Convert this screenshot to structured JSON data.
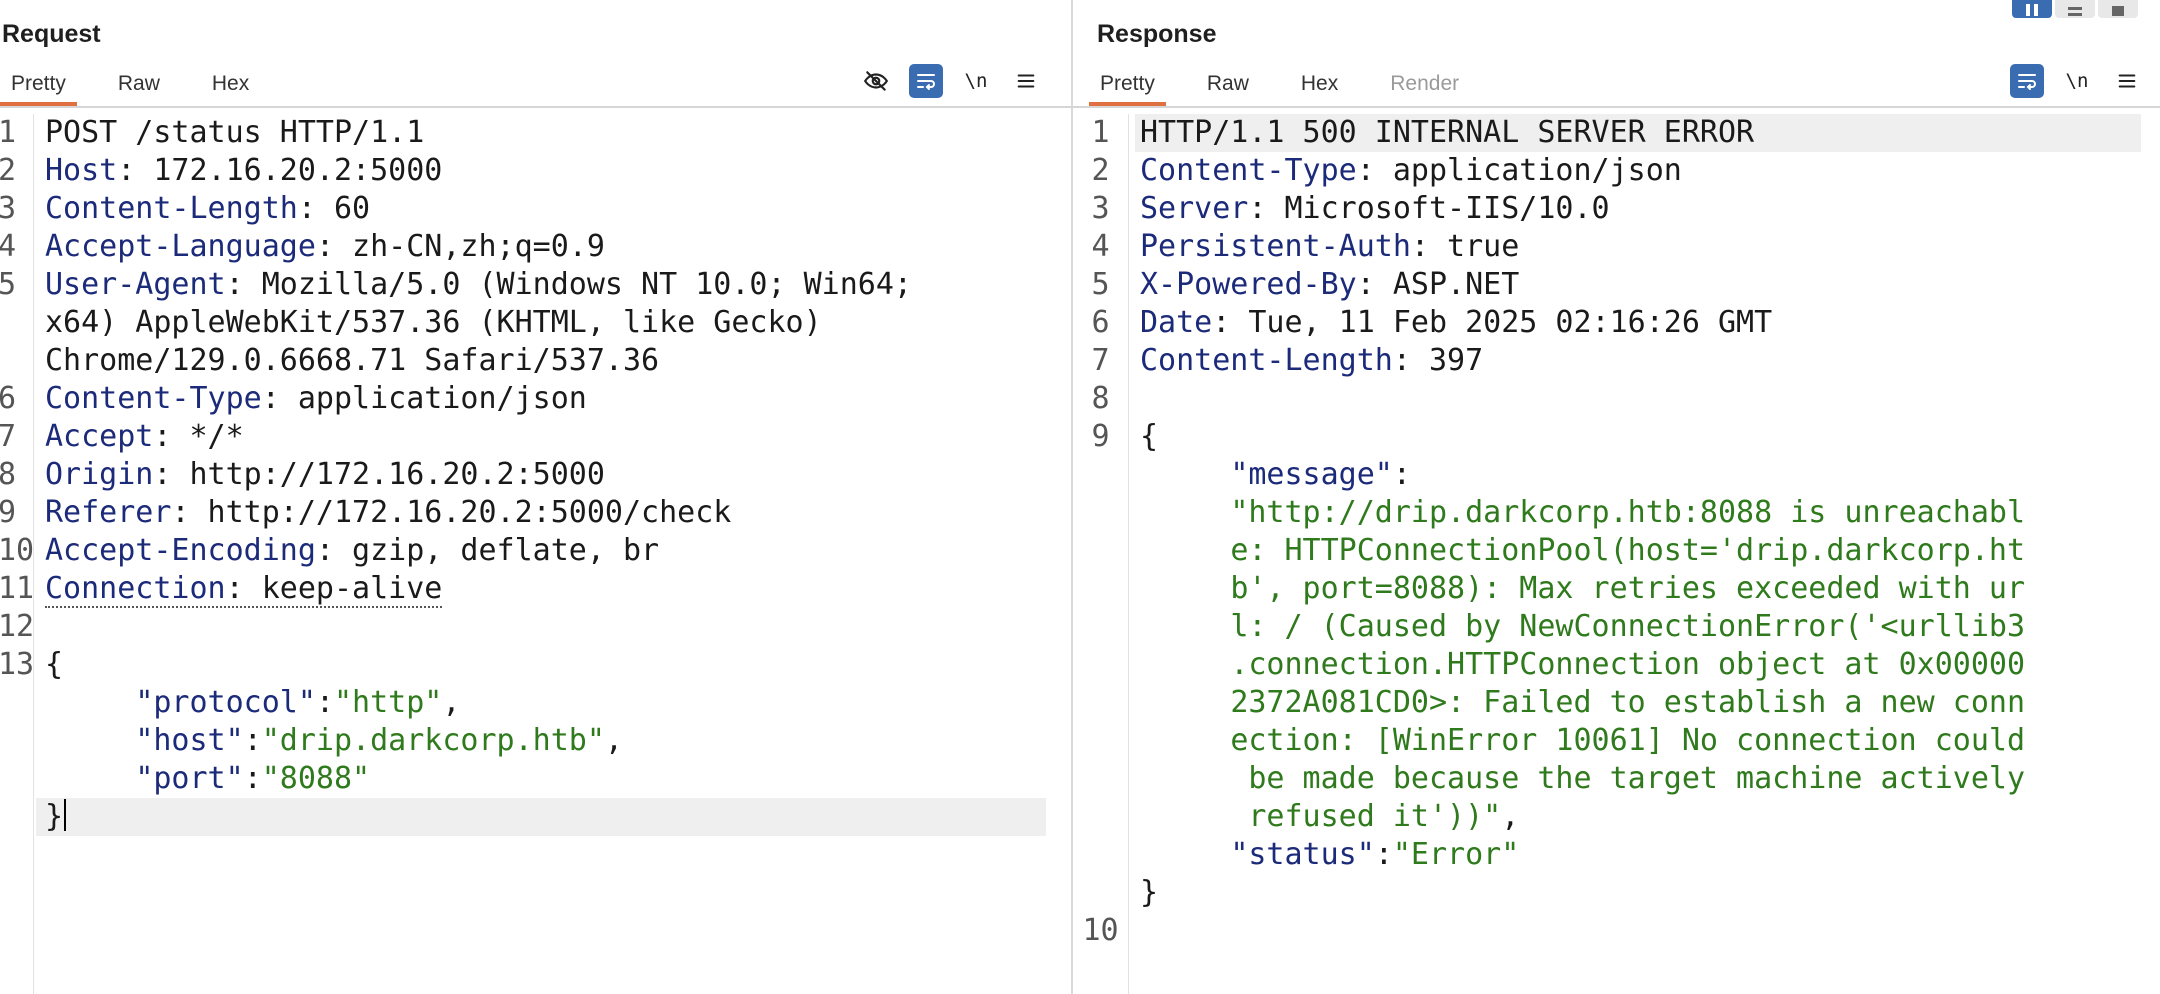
{
  "request": {
    "title": "Request",
    "tabs": [
      "Pretty",
      "Raw",
      "Hex"
    ],
    "active_tab": "Pretty",
    "toolbar_icons": [
      "eye-off-icon",
      "wrap-icon",
      "newline-icon",
      "menu-icon"
    ],
    "newline_label": "\\n",
    "line_numbers": [
      "1",
      "2",
      "3",
      "4",
      "5",
      "6",
      "7",
      "8",
      "9",
      "10",
      "11",
      "12",
      "13"
    ],
    "lines": {
      "l1": "POST /status HTTP/1.1",
      "h2_key": "Host",
      "h2_val": " 172.16.20.2:5000",
      "h3_key": "Content-Length",
      "h3_val": " 60",
      "h4_key": "Accept-Language",
      "h4_val": " zh-CN,zh;q=0.9",
      "h5_key": "User-Agent",
      "h5_val_a": " Mozilla/5.0 (Windows NT 10.0; Win64;",
      "h5_val_b": "x64) AppleWebKit/537.36 (KHTML, like Gecko)",
      "h5_val_c": "Chrome/129.0.6668.71 Safari/537.36",
      "h6_key": "Content-Type",
      "h6_val": " application/json",
      "h7_key": "Accept",
      "h7_val": " */*",
      "h8_key": "Origin",
      "h8_val": " http://172.16.20.2:5000",
      "h9_key": "Referer",
      "h9_val": " http://172.16.20.2:5000/check",
      "h10_key": "Accept-Encoding",
      "h10_val": " gzip, deflate, br",
      "h11_key": "Connection",
      "h11_val": " keep-alive",
      "brace_open": "{",
      "protocol_key": "\"protocol\"",
      "protocol_val": "\"http\"",
      "host_key": "\"host\"",
      "host_val": "\"drip.darkcorp.htb\"",
      "port_key": "\"port\"",
      "port_val": "\"8088\"",
      "brace_close": "}"
    }
  },
  "response": {
    "title": "Response",
    "tabs": [
      "Pretty",
      "Raw",
      "Hex",
      "Render"
    ],
    "active_tab": "Pretty",
    "disabled_tab": "Render",
    "toolbar_icons": [
      "wrap-icon",
      "newline-icon",
      "menu-icon"
    ],
    "newline_label": "\\n",
    "line_numbers": [
      "1",
      "2",
      "3",
      "4",
      "5",
      "6",
      "7",
      "8",
      "9",
      "10"
    ],
    "lines": {
      "l1": "HTTP/1.1 500 INTERNAL SERVER ERROR",
      "h2_key": "Content-Type",
      "h2_val": " application/json",
      "h3_key": "Server",
      "h3_val": " Microsoft-IIS/10.0",
      "h4_key": "Persistent-Auth",
      "h4_val": " true",
      "h5_key": "X-Powered-By",
      "h5_val": " ASP.NET",
      "h6_key": "Date",
      "h6_val": " Tue, 11 Feb 2025 02:16:26 GMT",
      "h7_key": "Content-Length",
      "h7_val": " 397",
      "brace_open": "{",
      "message_key": "\"message\"",
      "message_lines": [
        "\"http://drip.darkcorp.htb:8088 is unreachabl",
        "e: HTTPConnectionPool(host='drip.darkcorp.ht",
        "b', port=8088): Max retries exceeded with ur",
        "l: / (Caused by NewConnectionError('<urllib3",
        ".connection.HTTPConnection object at 0x00000",
        "2372A081CD0>: Failed to establish a new conn",
        "ection: [WinError 10061] No connection could",
        " be made because the target machine actively",
        " refused it'))\""
      ],
      "status_key": "\"status\"",
      "status_val": "\"Error\"",
      "brace_close": "}"
    }
  }
}
